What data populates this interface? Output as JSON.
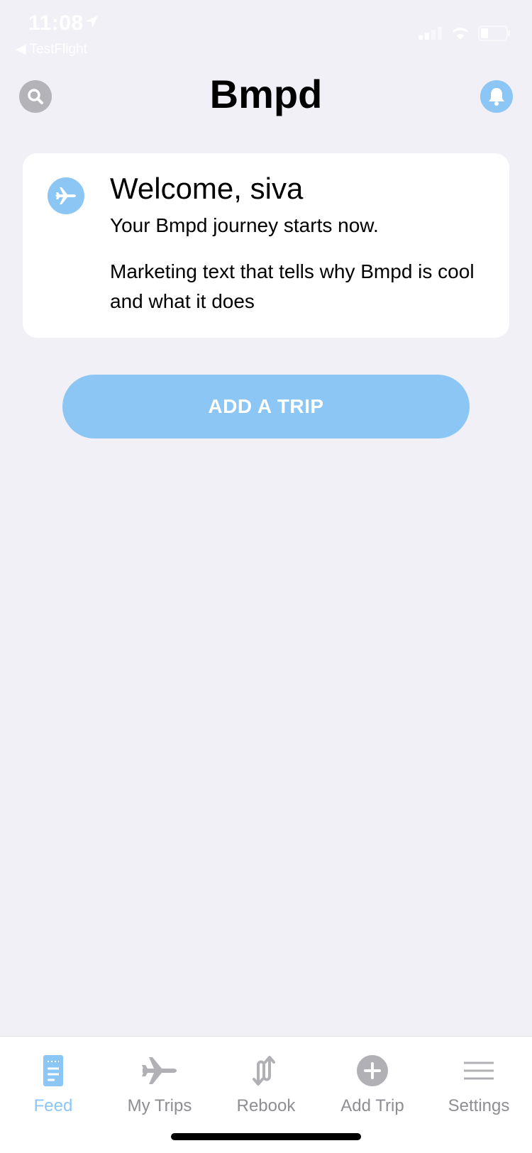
{
  "status_bar": {
    "time": "11:08",
    "back_app": "TestFlight"
  },
  "header": {
    "title": "Bmpd"
  },
  "welcome_card": {
    "title": "Welcome, siva",
    "subtitle": "Your Bmpd journey starts now.",
    "body": "Marketing text that tells why Bmpd is cool and what it does"
  },
  "actions": {
    "add_trip_label": "ADD A TRIP"
  },
  "tab_bar": {
    "active": "Feed",
    "items": [
      {
        "label": "Feed",
        "icon": "feed-icon"
      },
      {
        "label": "My Trips",
        "icon": "plane-icon"
      },
      {
        "label": "Rebook",
        "icon": "rebook-icon"
      },
      {
        "label": "Add Trip",
        "icon": "plus-circle-icon"
      },
      {
        "label": "Settings",
        "icon": "menu-icon"
      }
    ]
  },
  "colors": {
    "accent": "#8cc6f4",
    "background": "#f0f0f6",
    "inactive": "#8e8e93",
    "search_button": "#b4b4b8"
  }
}
